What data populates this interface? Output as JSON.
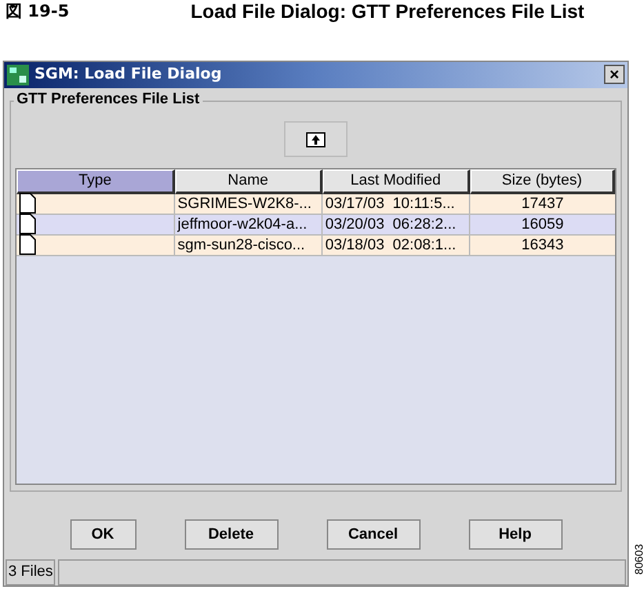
{
  "caption": {
    "number": "図 19-5",
    "title": "Load File Dialog: GTT Preferences File List"
  },
  "window": {
    "title": "SGM: Load File Dialog",
    "close": "×"
  },
  "group": {
    "title": "GTT Preferences File List"
  },
  "table": {
    "columns": [
      {
        "label": "Type",
        "sorted": true
      },
      {
        "label": "Name",
        "sorted": false
      },
      {
        "label": "Last Modified",
        "sorted": false
      },
      {
        "label": "Size (bytes)",
        "sorted": false
      }
    ],
    "rows": [
      {
        "name": "SGRIMES-W2K8-...",
        "modified": "03/17/03  10:11:5...",
        "size": "17437",
        "selected": false
      },
      {
        "name": "jeffmoor-w2k04-a...",
        "modified": "03/20/03  06:28:2...",
        "size": "16059",
        "selected": true
      },
      {
        "name": "sgm-sun28-cisco...",
        "modified": "03/18/03  02:08:1...",
        "size": "16343",
        "selected": false
      }
    ]
  },
  "buttons": [
    "OK",
    "Delete",
    "Cancel",
    "Help"
  ],
  "status_bar": {
    "text": "3 Files"
  },
  "figure_id": "80603"
}
